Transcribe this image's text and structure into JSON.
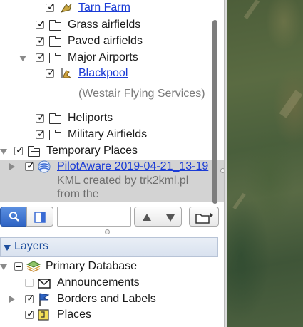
{
  "places_tree": {
    "items": [
      {
        "label": "Tarn Farm",
        "link": true
      },
      {
        "label": "Grass airfields"
      },
      {
        "label": "Paved airfields"
      },
      {
        "label": "Major Airports"
      },
      {
        "label": "Blackpool",
        "link": true
      },
      {
        "label": "(Westair Flying Services)"
      },
      {
        "label": "Heliports"
      },
      {
        "label": "Military Airfields"
      },
      {
        "label": "Temporary Places"
      },
      {
        "label": "PilotAware 2019-04-21_13-19",
        "link": true,
        "description_line1": "KML created by trk2kml.pl",
        "description_line2": "from the"
      }
    ]
  },
  "layers": {
    "header": "Layers",
    "items": [
      {
        "label": "Primary Database"
      },
      {
        "label": "Announcements"
      },
      {
        "label": "Borders and Labels"
      },
      {
        "label": "Places"
      }
    ]
  },
  "colors": {
    "link": "#1a3bd6",
    "selection": "#d3d3d3",
    "layers_header_text": "#1f4f9e"
  }
}
